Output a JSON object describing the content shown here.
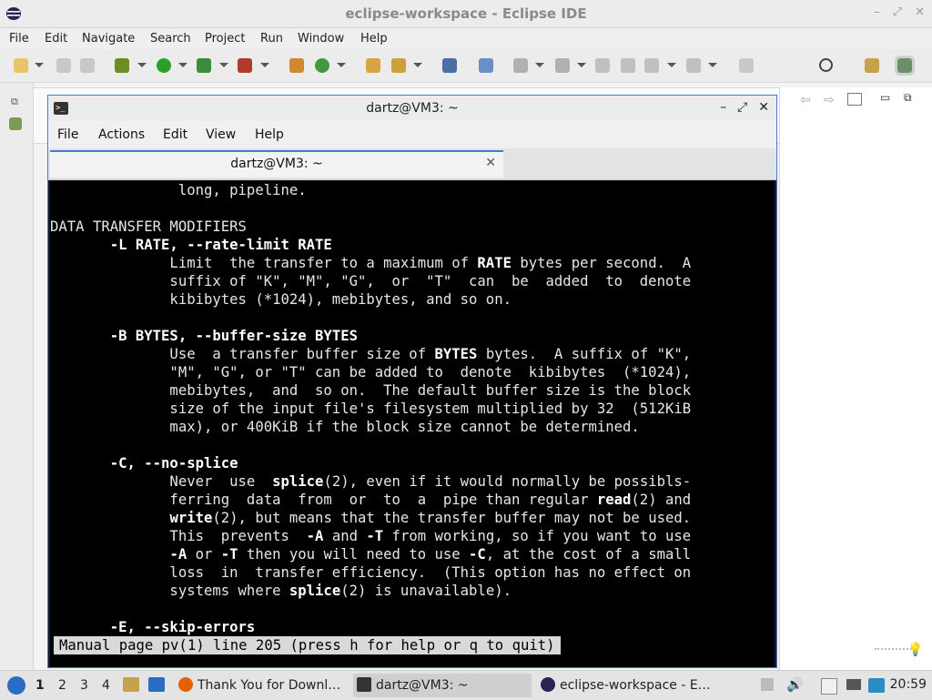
{
  "eclipse": {
    "title": "eclipse-workspace - Eclipse IDE",
    "menu": [
      "File",
      "Edit",
      "Navigate",
      "Search",
      "Project",
      "Run",
      "Window",
      "Help"
    ]
  },
  "terminal": {
    "title": "dartz@VM3: ~",
    "menu": [
      "File",
      "Actions",
      "Edit",
      "View",
      "Help"
    ],
    "tab_label": "dartz@VM3: ~",
    "lines": [
      [
        {
          "t": "               long, pipeline."
        }
      ],
      [],
      [
        {
          "t": "DATA TRANSFER MODIFIERS"
        }
      ],
      [
        {
          "t": "       "
        },
        {
          "t": "-L RATE, --rate-limit RATE",
          "b": true
        }
      ],
      [
        {
          "t": "              Limit  the transfer to a maximum of "
        },
        {
          "t": "RATE",
          "b": true
        },
        {
          "t": " bytes per second.  A"
        }
      ],
      [
        {
          "t": "              suffix of \"K\", \"M\", \"G\",  or  \"T\"  can  be  added  to  denote"
        }
      ],
      [
        {
          "t": "              kibibytes (*1024), mebibytes, and so on."
        }
      ],
      [],
      [
        {
          "t": "       "
        },
        {
          "t": "-B BYTES, --buffer-size BYTES",
          "b": true
        }
      ],
      [
        {
          "t": "              Use  a transfer buffer size of "
        },
        {
          "t": "BYTES",
          "b": true
        },
        {
          "t": " bytes.  A suffix of \"K\","
        }
      ],
      [
        {
          "t": "              \"M\", \"G\", or \"T\" can be added to  denote  kibibytes  (*1024),"
        }
      ],
      [
        {
          "t": "              mebibytes,  and  so on.  The default buffer size is the block"
        }
      ],
      [
        {
          "t": "              size of the input file's filesystem multiplied by 32  (512KiB"
        }
      ],
      [
        {
          "t": "              max), or 400KiB if the block size cannot be determined."
        }
      ],
      [],
      [
        {
          "t": "       "
        },
        {
          "t": "-C, --no-splice",
          "b": true
        }
      ],
      [
        {
          "t": "              Never  use  "
        },
        {
          "t": "splice",
          "b": true
        },
        {
          "t": "(2), even if it would normally be possibls-"
        }
      ],
      [
        {
          "t": "              ferring  data  from  or  to  a  pipe than regular "
        },
        {
          "t": "read",
          "b": true
        },
        {
          "t": "(2) and"
        }
      ],
      [
        {
          "t": "              "
        },
        {
          "t": "write",
          "b": true
        },
        {
          "t": "(2), but means that the transfer buffer may not be used."
        }
      ],
      [
        {
          "t": "              This  prevents  "
        },
        {
          "t": "-A",
          "b": true
        },
        {
          "t": " and "
        },
        {
          "t": "-T",
          "b": true
        },
        {
          "t": " from working, so if you want to use"
        }
      ],
      [
        {
          "t": "              "
        },
        {
          "t": "-A",
          "b": true
        },
        {
          "t": " or "
        },
        {
          "t": "-T",
          "b": true
        },
        {
          "t": " then you will need to use "
        },
        {
          "t": "-C",
          "b": true
        },
        {
          "t": ", at the cost of a small"
        }
      ],
      [
        {
          "t": "              loss  in  transfer efficiency.  (This option has no effect on"
        }
      ],
      [
        {
          "t": "              systems where "
        },
        {
          "t": "splice",
          "b": true
        },
        {
          "t": "(2) is unavailable)."
        }
      ],
      [],
      [
        {
          "t": "       "
        },
        {
          "t": "-E, --skip-errors",
          "b": true
        }
      ]
    ],
    "status": "Manual page pv(1) line 205 (press h for help or q to quit)"
  },
  "taskbar": {
    "workspaces": [
      "1",
      "2",
      "3",
      "4"
    ],
    "tasks": [
      {
        "label": "Thank You for Downl…",
        "icon": "firefox-icon"
      },
      {
        "label": "dartz@VM3: ~",
        "icon": "terminal-icon"
      },
      {
        "label": "eclipse-workspace - E…",
        "icon": "eclipse-icon"
      }
    ],
    "clock": "20:59"
  }
}
